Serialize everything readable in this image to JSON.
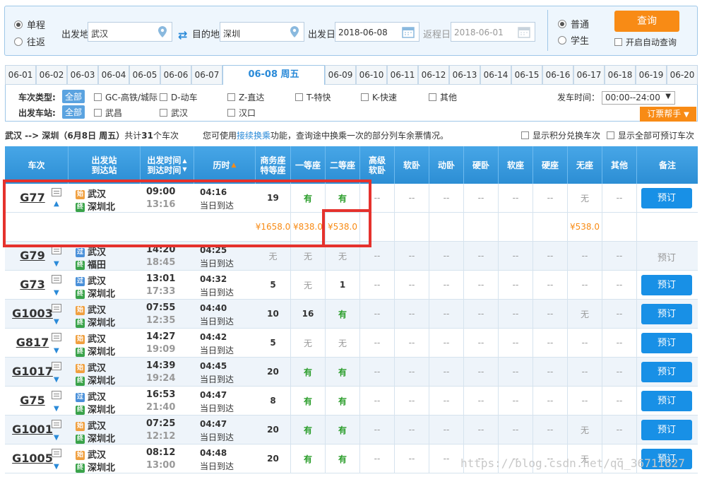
{
  "query": {
    "trip_types": [
      "单程",
      "往返"
    ],
    "from_label": "出发地",
    "from_value": "武汉",
    "to_label": "目的地",
    "to_value": "深圳",
    "depart_label": "出发日",
    "depart_value": "2018-06-08",
    "return_label": "返程日",
    "return_value": "2018-06-01",
    "passenger_types": [
      "普通",
      "学生"
    ],
    "search_label": "查询",
    "auto_query_label": "开启自动查询"
  },
  "date_tabs": [
    "06-01",
    "06-02",
    "06-03",
    "06-04",
    "06-05",
    "06-06",
    "06-07",
    "06-08 周五",
    "06-09",
    "06-10",
    "06-11",
    "06-12",
    "06-13",
    "06-14",
    "06-15",
    "06-16",
    "06-17",
    "06-18",
    "06-19",
    "06-20"
  ],
  "filters": {
    "type_label": "车次类型:",
    "all": "全部",
    "types": [
      "GC-高铁/城际",
      "D-动车",
      "Z-直达",
      "T-特快",
      "K-快速",
      "其他"
    ],
    "station_label": "出发车站:",
    "stations": [
      "武昌",
      "武汉",
      "汉口"
    ],
    "time_label": "发车时间：",
    "time_value": "00:00--24:00",
    "help": "订票帮手"
  },
  "info": {
    "route": "武汉 --> 深圳（6月8日  周五）",
    "count_prefix": "共计",
    "count": "31",
    "count_suffix": "个车次",
    "tip_pre": "您可使用",
    "tip_link": "接续换乘",
    "tip_post": "功能，查询途中换乘一次的部分列车余票情况。",
    "opt1": "显示积分兑换车次",
    "opt2": "显示全部可预订车次"
  },
  "headers": [
    "车次",
    "出发站\n到达站",
    "出发时间\n到达时间",
    "历时",
    "商务座\n特等座",
    "一等座",
    "二等座",
    "高级\n软卧",
    "软卧",
    "动卧",
    "硬卧",
    "软座",
    "硬座",
    "无座",
    "其他",
    "备注"
  ],
  "trains": [
    {
      "no": "G77",
      "from": "武汉",
      "to": "深圳北",
      "fb": "始",
      "tb": "终",
      "dep": "09:00",
      "arr": "13:16",
      "dur": "04:16",
      "day": "当日到达",
      "seats": [
        "19",
        "有",
        "有",
        "--",
        "--",
        "--",
        "--",
        "--",
        "--",
        "无",
        "--"
      ],
      "book": "预订",
      "bookable": true
    },
    {
      "no": "G79",
      "from": "武汉",
      "to": "福田",
      "fb": "过",
      "tb": "终",
      "dep": "14:20",
      "arr": "18:45",
      "dur": "04:25",
      "day": "当日到达",
      "seats": [
        "无",
        "无",
        "无",
        "--",
        "--",
        "--",
        "--",
        "--",
        "--",
        "--",
        "--"
      ],
      "book": "预订",
      "bookable": false
    },
    {
      "no": "G73",
      "from": "武汉",
      "to": "深圳北",
      "fb": "过",
      "tb": "终",
      "dep": "13:01",
      "arr": "17:33",
      "dur": "04:32",
      "day": "当日到达",
      "seats": [
        "5",
        "无",
        "1",
        "--",
        "--",
        "--",
        "--",
        "--",
        "--",
        "--",
        "--"
      ],
      "book": "预订",
      "bookable": true
    },
    {
      "no": "G1003",
      "from": "武汉",
      "to": "深圳北",
      "fb": "始",
      "tb": "终",
      "dep": "07:55",
      "arr": "12:35",
      "dur": "04:40",
      "day": "当日到达",
      "seats": [
        "10",
        "16",
        "有",
        "--",
        "--",
        "--",
        "--",
        "--",
        "--",
        "无",
        "--"
      ],
      "book": "预订",
      "bookable": true
    },
    {
      "no": "G817",
      "from": "武汉",
      "to": "深圳北",
      "fb": "始",
      "tb": "终",
      "dep": "14:27",
      "arr": "19:09",
      "dur": "04:42",
      "day": "当日到达",
      "seats": [
        "5",
        "无",
        "无",
        "--",
        "--",
        "--",
        "--",
        "--",
        "--",
        "--",
        "--"
      ],
      "book": "预订",
      "bookable": true
    },
    {
      "no": "G1017",
      "from": "武汉",
      "to": "深圳北",
      "fb": "始",
      "tb": "终",
      "dep": "14:39",
      "arr": "19:24",
      "dur": "04:45",
      "day": "当日到达",
      "seats": [
        "20",
        "有",
        "有",
        "--",
        "--",
        "--",
        "--",
        "--",
        "--",
        "--",
        "--"
      ],
      "book": "预订",
      "bookable": true
    },
    {
      "no": "G75",
      "from": "武汉",
      "to": "深圳北",
      "fb": "过",
      "tb": "终",
      "dep": "16:53",
      "arr": "21:40",
      "dur": "04:47",
      "day": "当日到达",
      "seats": [
        "8",
        "有",
        "有",
        "--",
        "--",
        "--",
        "--",
        "--",
        "--",
        "--",
        "--"
      ],
      "book": "预订",
      "bookable": true
    },
    {
      "no": "G1001",
      "from": "武汉",
      "to": "深圳北",
      "fb": "始",
      "tb": "终",
      "dep": "07:25",
      "arr": "12:12",
      "dur": "04:47",
      "day": "当日到达",
      "seats": [
        "20",
        "有",
        "有",
        "--",
        "--",
        "--",
        "--",
        "--",
        "--",
        "无",
        "--"
      ],
      "book": "预订",
      "bookable": true
    },
    {
      "no": "G1005",
      "from": "武汉",
      "to": "深圳北",
      "fb": "始",
      "tb": "终",
      "dep": "08:12",
      "arr": "13:00",
      "dur": "04:48",
      "day": "当日到达",
      "seats": [
        "20",
        "有",
        "有",
        "--",
        "--",
        "--",
        "--",
        "--",
        "--",
        "无",
        "--"
      ],
      "book": "预订",
      "bookable": true
    }
  ],
  "prices": {
    "business": "¥1658.0",
    "first": "¥838.0",
    "second": "¥538.0",
    "noseat": "¥538.0"
  },
  "colors": {
    "accent": "#f88b15",
    "blue": "#1890e6",
    "highlight": "#e5322d"
  },
  "watermark": "https://blog.csdn.net/qq_36711627"
}
